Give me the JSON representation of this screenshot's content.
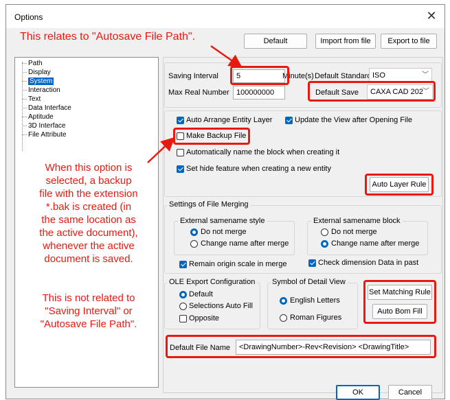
{
  "window": {
    "title": "Options",
    "close_symbol": "✕"
  },
  "annotations": {
    "top": "This relates to \"Autosave File Path\".",
    "left_block1": [
      "When this option is",
      "selected, a backup",
      "file with the extension",
      "*.bak is created (in",
      "the same location as",
      "the active document),",
      "whenever the active",
      "document is saved."
    ],
    "left_block2": [
      "This is not related to",
      "\"Saving Interval\" or",
      "\"Autosave File Path\"."
    ]
  },
  "toolbar": {
    "default": "Default",
    "import": "Import from file",
    "export": "Export to file"
  },
  "tree": {
    "items": [
      {
        "label": "Path",
        "selected": false
      },
      {
        "label": "Display",
        "selected": false
      },
      {
        "label": "System",
        "selected": true
      },
      {
        "label": "Interaction",
        "selected": false
      },
      {
        "label": "Text",
        "selected": false
      },
      {
        "label": "Data Interface",
        "selected": false
      },
      {
        "label": "Aptitude",
        "selected": false
      },
      {
        "label": "3D Interface",
        "selected": false
      },
      {
        "label": "File Attribute",
        "selected": false
      }
    ]
  },
  "general": {
    "saving_interval_label": "Saving Interval",
    "saving_interval_value": "5",
    "minutes_label": "Minute(s)",
    "default_standard_label": "Default Standard",
    "default_standard_value": "ISO",
    "max_real_label": "Max Real Number",
    "max_real_value": "100000000",
    "default_save_label": "Default Save",
    "default_save_value": "CAXA CAD 202"
  },
  "options": {
    "auto_arrange": "Auto Arrange Entity Layer",
    "update_view": "Update the View after Opening File",
    "backup": "Make Backup File",
    "auto_name_block": "Automatically name the block when creating it",
    "hide_feature": "Set hide feature when creating a new entity",
    "auto_layer_rule": "Auto Layer Rule"
  },
  "merging": {
    "title": "Settings of File Merging",
    "style_title": "External samename style",
    "block_title": "External samename block",
    "do_not_merge": "Do not merge",
    "change_name": "Change name after merge",
    "remain_scale": "Remain origin scale in merge",
    "check_dimension": "Check dimension Data in past"
  },
  "ole": {
    "title": "OLE Export Configuration",
    "default": "Default",
    "auto_fill": "Selections Auto Fill",
    "opposite": "Opposite"
  },
  "symbol": {
    "title": "Symbol of Detail View",
    "english": "English Letters",
    "roman": "Roman Figures"
  },
  "side_buttons": {
    "matching": "Set Matching Rule",
    "bom": "Auto Bom Fill"
  },
  "file_name": {
    "label": "Default File Name",
    "value": "<DrawingNumber>-Rev<Revision> <DrawingTitle>"
  },
  "footer": {
    "ok": "OK",
    "cancel": "Cancel"
  },
  "colors": {
    "annotation_red": "#e8190f",
    "accent_blue": "#0067c0",
    "dialog_bg": "#f0f0f0"
  }
}
